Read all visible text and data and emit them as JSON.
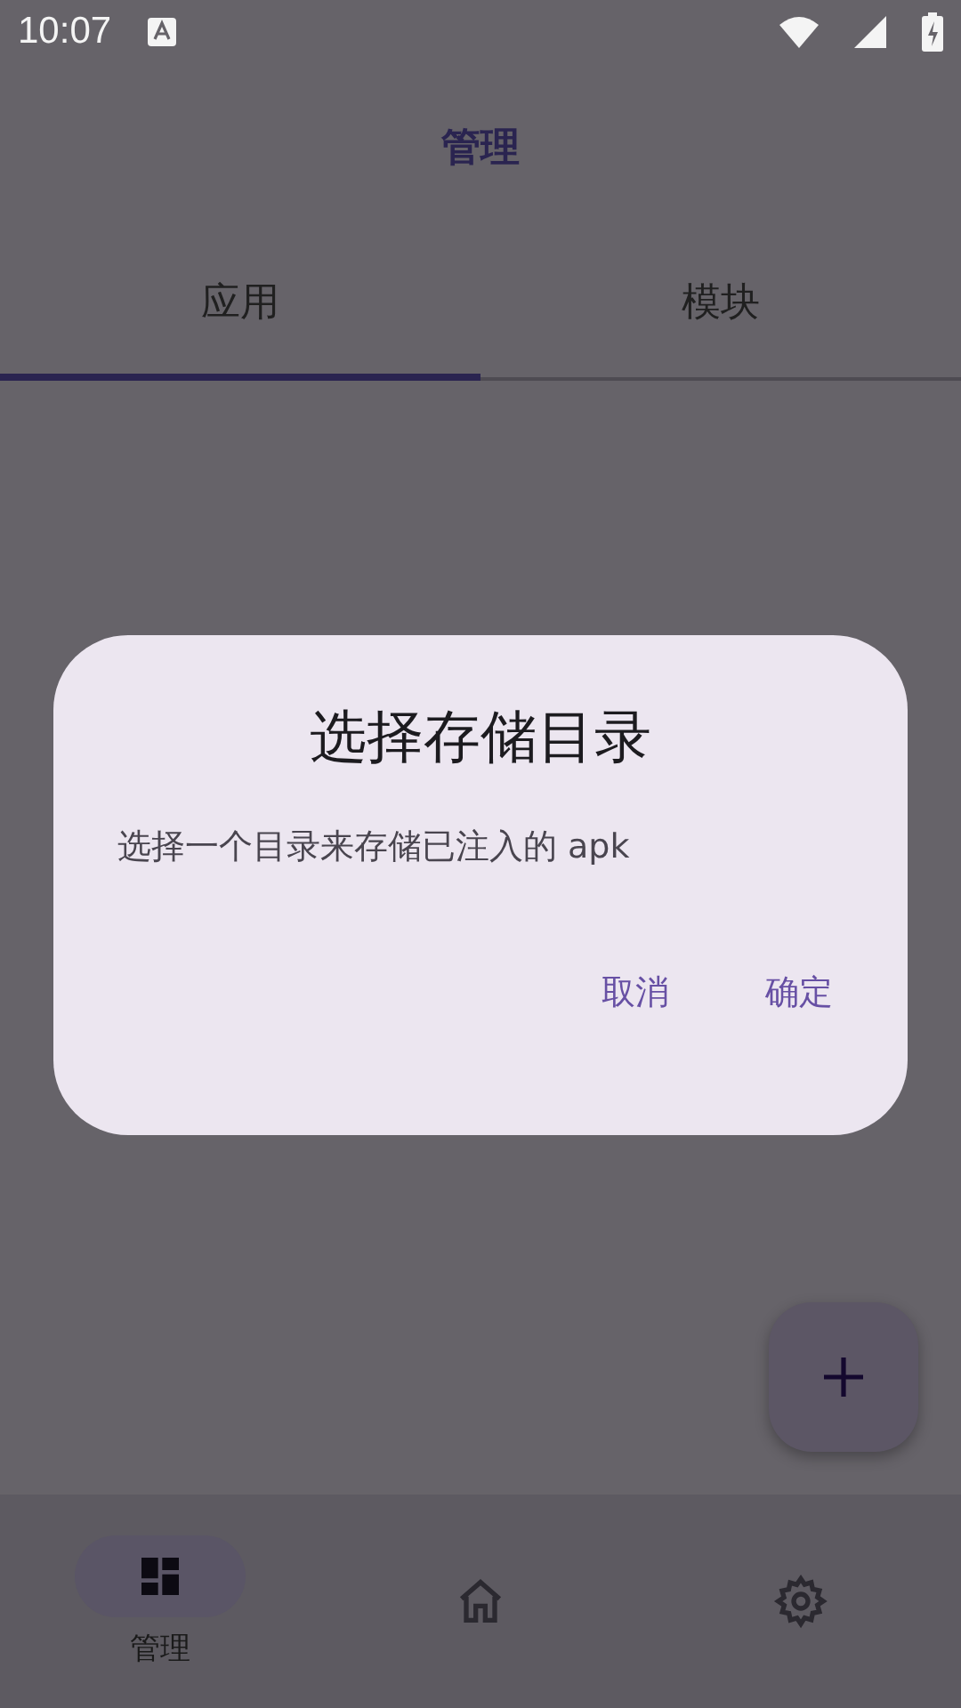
{
  "status_bar": {
    "time": "10:07"
  },
  "app_bar": {
    "title": "管理"
  },
  "tabs": [
    {
      "label": "应用",
      "selected": true
    },
    {
      "label": "模块",
      "selected": false
    }
  ],
  "bottom_nav": [
    {
      "kind": "dashboard",
      "label": "管理",
      "selected": true
    },
    {
      "kind": "home",
      "selected": false
    },
    {
      "kind": "settings",
      "selected": false
    }
  ],
  "dialog": {
    "title": "选择存储目录",
    "message": "选择一个目录来存储已注入的 apk",
    "buttons": [
      "取消",
      "确定"
    ]
  }
}
